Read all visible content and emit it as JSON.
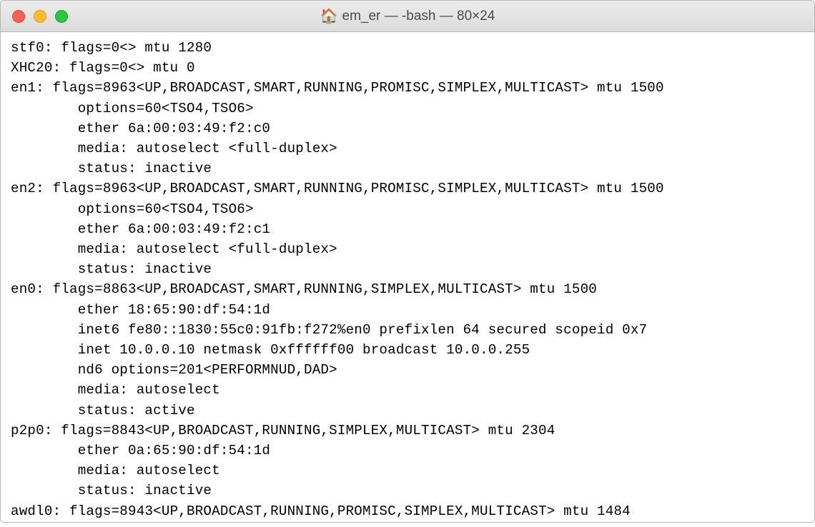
{
  "window": {
    "title": "em_er — -bash — 80×24"
  },
  "lines": [
    "stf0: flags=0<> mtu 1280",
    "XHC20: flags=0<> mtu 0",
    "en1: flags=8963<UP,BROADCAST,SMART,RUNNING,PROMISC,SIMPLEX,MULTICAST> mtu 1500",
    "        options=60<TSO4,TSO6>",
    "        ether 6a:00:03:49:f2:c0",
    "        media: autoselect <full-duplex>",
    "        status: inactive",
    "en2: flags=8963<UP,BROADCAST,SMART,RUNNING,PROMISC,SIMPLEX,MULTICAST> mtu 1500",
    "        options=60<TSO4,TSO6>",
    "        ether 6a:00:03:49:f2:c1",
    "        media: autoselect <full-duplex>",
    "        status: inactive",
    "en0: flags=8863<UP,BROADCAST,SMART,RUNNING,SIMPLEX,MULTICAST> mtu 1500",
    "        ether 18:65:90:df:54:1d",
    "        inet6 fe80::1830:55c0:91fb:f272%en0 prefixlen 64 secured scopeid 0x7",
    "        inet 10.0.0.10 netmask 0xffffff00 broadcast 10.0.0.255",
    "        nd6 options=201<PERFORMNUD,DAD>",
    "        media: autoselect",
    "        status: active",
    "p2p0: flags=8843<UP,BROADCAST,RUNNING,SIMPLEX,MULTICAST> mtu 2304",
    "        ether 0a:65:90:df:54:1d",
    "        media: autoselect",
    "        status: inactive",
    "awdl0: flags=8943<UP,BROADCAST,RUNNING,PROMISC,SIMPLEX,MULTICAST> mtu 1484"
  ]
}
